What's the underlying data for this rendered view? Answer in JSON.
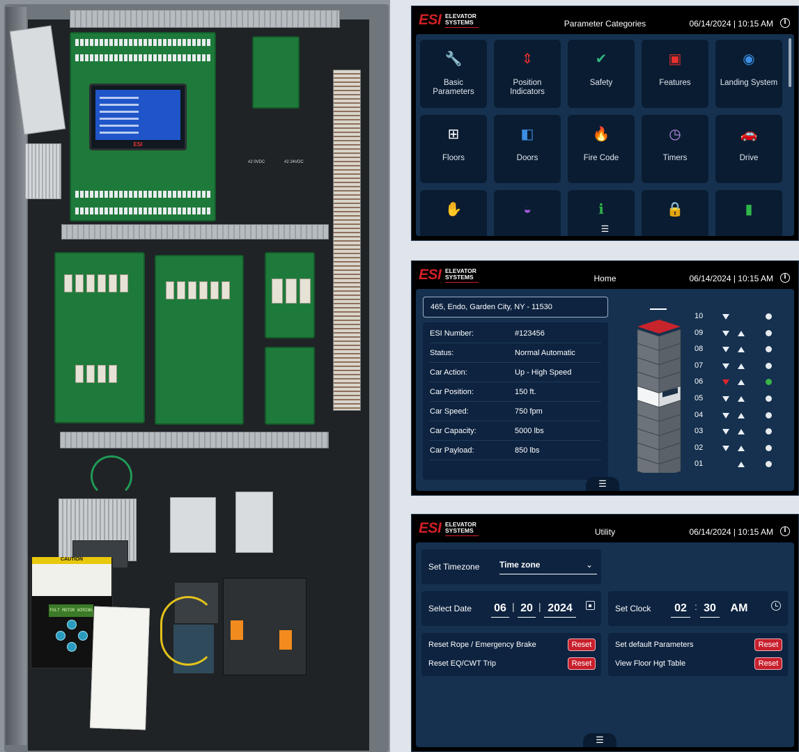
{
  "brand": {
    "logo_mark": "ESI",
    "logo_line1": "ELEVATOR",
    "logo_line2": "SYSTEMS"
  },
  "photo": {
    "screen_brand": "ESI",
    "caution_title": "CAUTION",
    "drive_display": "FULT MOTOR WIRING",
    "terminal_labels": [
      "#2 0VDC",
      "#2 24VDC"
    ]
  },
  "parameters_screen": {
    "title": "Parameter Categories",
    "datetime": "06/14/2024 | 10:15 AM",
    "tiles": [
      {
        "label": "Basic Parameters",
        "icon": "wrench-icon",
        "glyph": "🔧",
        "color": "#f3c52f"
      },
      {
        "label": "Position Indicators",
        "icon": "updown-arrows-icon",
        "glyph": "⇕",
        "color": "#e5302d"
      },
      {
        "label": "Safety",
        "icon": "shield-check-icon",
        "glyph": "✔",
        "color": "#2fb57e"
      },
      {
        "label": "Features",
        "icon": "gift-icon",
        "glyph": "▣",
        "color": "#e5302d"
      },
      {
        "label": "Landing System",
        "icon": "landing-icon",
        "glyph": "◉",
        "color": "#3c8ee3"
      },
      {
        "label": "Floors",
        "icon": "floorplan-icon",
        "glyph": "⊞",
        "color": "#ffffff"
      },
      {
        "label": "Doors",
        "icon": "doors-icon",
        "glyph": "◧",
        "color": "#3c8ee3"
      },
      {
        "label": "Fire Code",
        "icon": "fire-icon",
        "glyph": "🔥",
        "color": "#f07a18"
      },
      {
        "label": "Timers",
        "icon": "clock-icon",
        "glyph": "◷",
        "color": "#b78ee6"
      },
      {
        "label": "Drive",
        "icon": "car-icon",
        "glyph": "🚗",
        "color": "#f3c52f"
      },
      {
        "label": "",
        "icon": "stop-hand-icon",
        "glyph": "✋",
        "color": "#e5302d"
      },
      {
        "label": "",
        "icon": "gauge-icon",
        "glyph": "◒",
        "color": "#9c5ad8"
      },
      {
        "label": "",
        "icon": "info-icon",
        "glyph": "ℹ",
        "color": "#2fb54a"
      },
      {
        "label": "",
        "icon": "lock-icon",
        "glyph": "🔒",
        "color": "#f07a18"
      },
      {
        "label": "",
        "icon": "remote-icon",
        "glyph": "▮",
        "color": "#2fb54a"
      }
    ],
    "menu_glyph": "☰"
  },
  "home_screen": {
    "title": "Home",
    "datetime": "06/14/2024 | 10:15 AM",
    "address": "465, Endo, Garden City, NY - 11530",
    "info": [
      {
        "key": "ESI Number:",
        "value": "#123456"
      },
      {
        "key": "Status:",
        "value": "Normal Automatic"
      },
      {
        "key": "Car Action:",
        "value": "Up - High Speed"
      },
      {
        "key": "Car Position:",
        "value": "150 ft."
      },
      {
        "key": "Car Speed:",
        "value": "750 fpm"
      },
      {
        "key": "Car Capacity:",
        "value": "5000 lbs"
      },
      {
        "key": "Car Payload:",
        "value": "850 lbs"
      }
    ],
    "floors": [
      {
        "num": "10",
        "down": true,
        "up": false,
        "down_active": false,
        "here": false
      },
      {
        "num": "09",
        "down": true,
        "up": true,
        "down_active": false,
        "here": false
      },
      {
        "num": "08",
        "down": true,
        "up": true,
        "down_active": false,
        "here": false
      },
      {
        "num": "07",
        "down": true,
        "up": true,
        "down_active": false,
        "here": false
      },
      {
        "num": "06",
        "down": true,
        "up": true,
        "down_active": true,
        "here": true
      },
      {
        "num": "05",
        "down": true,
        "up": true,
        "down_active": false,
        "here": false
      },
      {
        "num": "04",
        "down": true,
        "up": true,
        "down_active": false,
        "here": false
      },
      {
        "num": "03",
        "down": true,
        "up": true,
        "down_active": false,
        "here": false
      },
      {
        "num": "02",
        "down": true,
        "up": true,
        "down_active": false,
        "here": false
      },
      {
        "num": "01",
        "down": false,
        "up": true,
        "down_active": false,
        "here": false
      }
    ],
    "current_floor": "06",
    "menu_glyph": "☰"
  },
  "utility_screen": {
    "title": "Utility",
    "datetime": "06/14/2024 | 10:15 AM",
    "timezone_label": "Set Timezone",
    "timezone_value": "Time zone",
    "date_label": "Select Date",
    "date_month": "06",
    "date_day": "20",
    "date_year": "2024",
    "date_sep": "|",
    "clock_label": "Set Clock",
    "clock_hour": "02",
    "clock_sep": ":",
    "clock_minute": "30",
    "clock_ampm": "AM",
    "left_actions": [
      {
        "label": "Reset Rope / Emergency Brake",
        "button": "Reset"
      },
      {
        "label": "Reset EQ/CWT Trip",
        "button": "Reset"
      }
    ],
    "right_actions": [
      {
        "label": "Set default Parameters",
        "button": "Reset"
      },
      {
        "label": "View Floor Hgt Table",
        "button": "Reset"
      }
    ],
    "chevron_glyph": "⌄",
    "menu_glyph": "☰"
  },
  "colors": {
    "accent_red": "#d21f26",
    "panel_blue": "#15314f",
    "card_blue": "#0d2340",
    "active_green": "#39b54a"
  }
}
